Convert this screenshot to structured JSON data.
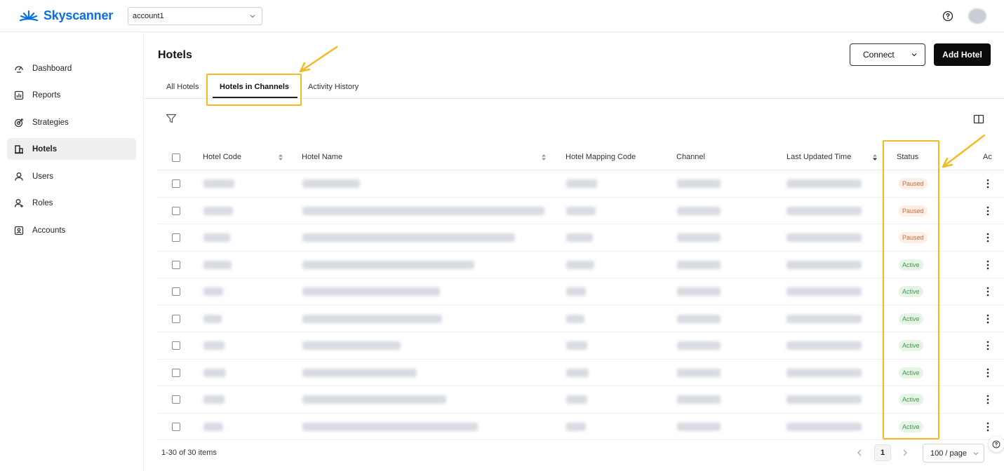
{
  "app": {
    "brand": "Skyscanner",
    "account_select": {
      "value": "account1"
    }
  },
  "sidebar": {
    "items": [
      {
        "label": "Dashboard",
        "icon": "dashboard-icon",
        "active": false
      },
      {
        "label": "Reports",
        "icon": "reports-icon",
        "active": false
      },
      {
        "label": "Strategies",
        "icon": "strategies-icon",
        "active": false
      },
      {
        "label": "Hotels",
        "icon": "hotels-icon",
        "active": true
      },
      {
        "label": "Users",
        "icon": "user-icon",
        "active": false
      },
      {
        "label": "Roles",
        "icon": "roles-icon",
        "active": false
      },
      {
        "label": "Accounts",
        "icon": "accounts-icon",
        "active": false
      }
    ]
  },
  "page": {
    "title": "Hotels",
    "connect_label": "Connect",
    "add_label": "Add Hotel",
    "tabs": [
      "All Hotels",
      "Hotels in Channels",
      "Activity History"
    ],
    "active_tab": 1
  },
  "table": {
    "headers": [
      "Hotel Code",
      "Hotel Name",
      "Hotel Mapping Code",
      "Channel",
      "Last Updated Time",
      "Status",
      "Ac"
    ],
    "rows": [
      {
        "status": "Paused"
      },
      {
        "status": "Paused"
      },
      {
        "status": "Paused"
      },
      {
        "status": "Active"
      },
      {
        "status": "Active"
      },
      {
        "status": "Active"
      },
      {
        "status": "Active"
      },
      {
        "status": "Active"
      },
      {
        "status": "Active"
      },
      {
        "status": "Active"
      }
    ]
  },
  "footer": {
    "count_text": "1-30 of 30 items",
    "current_page": "1",
    "page_size": "100 / page"
  },
  "colors": {
    "brand": "#0770e3",
    "highlight": "#f5b923",
    "paused": "#cf6b3a",
    "active": "#3f9a46"
  }
}
